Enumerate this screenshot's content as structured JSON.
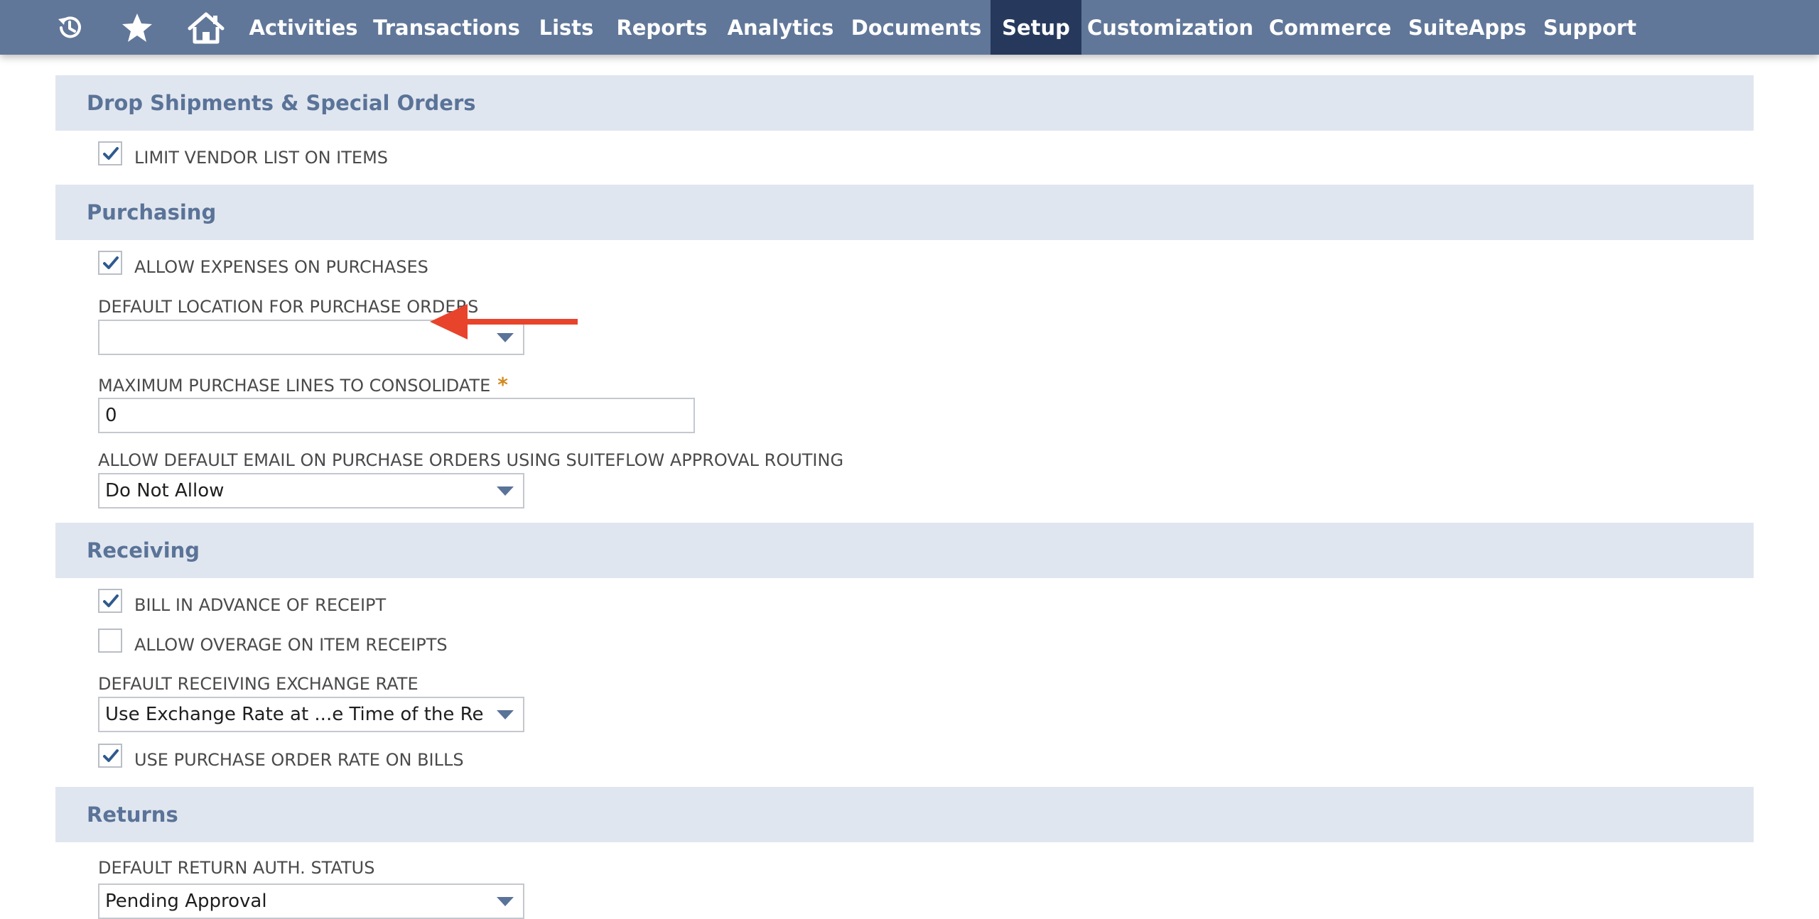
{
  "nav": {
    "icons": [
      {
        "name": "recent-records-icon"
      },
      {
        "name": "favorites-star-icon"
      },
      {
        "name": "home-icon"
      }
    ],
    "items": [
      {
        "label": "Activities",
        "active": false
      },
      {
        "label": "Transactions",
        "active": false
      },
      {
        "label": "Lists",
        "active": false
      },
      {
        "label": "Reports",
        "active": false
      },
      {
        "label": "Analytics",
        "active": false
      },
      {
        "label": "Documents",
        "active": false
      },
      {
        "label": "Setup",
        "active": true
      },
      {
        "label": "Customization",
        "active": false
      },
      {
        "label": "Commerce",
        "active": false
      },
      {
        "label": "SuiteApps",
        "active": false
      },
      {
        "label": "Support",
        "active": false
      }
    ]
  },
  "sections": {
    "drop_shipments": {
      "title": "Drop Shipments & Special Orders",
      "limit_vendor_list": {
        "label": "LIMIT VENDOR LIST ON ITEMS",
        "checked": true
      }
    },
    "purchasing": {
      "title": "Purchasing",
      "allow_expenses": {
        "label": "ALLOW EXPENSES ON PURCHASES",
        "checked": true
      },
      "default_location": {
        "label": "DEFAULT LOCATION FOR PURCHASE ORDERS",
        "value": ""
      },
      "max_lines": {
        "label": "MAXIMUM PURCHASE LINES TO CONSOLIDATE",
        "required_mark": "*",
        "value": "0"
      },
      "default_email": {
        "label": "ALLOW DEFAULT EMAIL ON PURCHASE ORDERS USING SUITEFLOW APPROVAL ROUTING",
        "value": "Do Not Allow"
      }
    },
    "receiving": {
      "title": "Receiving",
      "bill_in_advance": {
        "label": "BILL IN ADVANCE OF RECEIPT",
        "checked": true
      },
      "allow_overage": {
        "label": "ALLOW OVERAGE ON ITEM RECEIPTS",
        "checked": false
      },
      "exchange_rate": {
        "label": "DEFAULT RECEIVING EXCHANGE RATE",
        "value": "Use Exchange Rate at ...e Time of the Receipt"
      },
      "use_po_rate": {
        "label": "USE PURCHASE ORDER RATE ON BILLS",
        "checked": true
      }
    },
    "returns": {
      "title": "Returns",
      "default_return_status": {
        "label": "DEFAULT RETURN AUTH. STATUS",
        "value": "Pending Approval"
      }
    }
  },
  "colors": {
    "nav_bg": "#607799",
    "nav_active": "#26395d",
    "section_bg": "#e0e6ef",
    "section_title": "#5a7398",
    "check": "#2f5a8f",
    "annotation_arrow": "#e8442c",
    "required_star": "#d18a1e"
  }
}
